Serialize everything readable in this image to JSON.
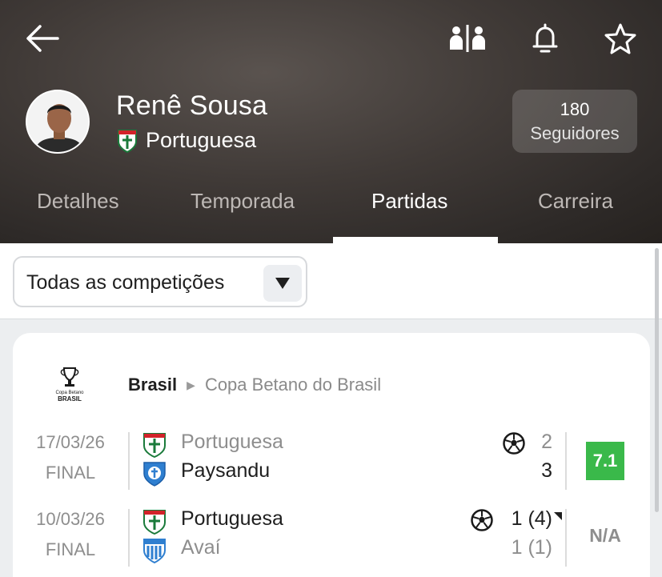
{
  "header": {
    "player_name": "Renê Sousa",
    "team": "Portuguesa",
    "followers_count": "180",
    "followers_label": "Seguidores",
    "icons": [
      "back-arrow-icon",
      "compare-players-icon",
      "bell-icon",
      "star-icon"
    ]
  },
  "tabs": [
    {
      "label": "Detalhes",
      "active": false
    },
    {
      "label": "Temporada",
      "active": false
    },
    {
      "label": "Partidas",
      "active": true
    },
    {
      "label": "Carreira",
      "active": false
    }
  ],
  "filter": {
    "selected": "Todas as competições"
  },
  "competition": {
    "country": "Brasil",
    "name": "Copa Betano do Brasil",
    "logo_text_top": "Copa Betano",
    "logo_text_bottom": "BRASIL"
  },
  "matches": [
    {
      "date": "17/03/26",
      "status": "FINAL",
      "home": {
        "name": "Portuguesa",
        "score": "2",
        "winner": false
      },
      "away": {
        "name": "Paysandu",
        "score": "3",
        "winner": true
      },
      "player_goal_row": "home",
      "rating": "7.1"
    },
    {
      "date": "10/03/26",
      "status": "FINAL",
      "home": {
        "name": "Portuguesa",
        "score": "1 (4)",
        "winner": true
      },
      "away": {
        "name": "Avaí",
        "score": "1 (1)",
        "winner": false
      },
      "player_goal_row": "home",
      "rating": "N/A"
    }
  ],
  "colors": {
    "rating_green": "#3ab94a",
    "header_dark": "#3a3431"
  }
}
